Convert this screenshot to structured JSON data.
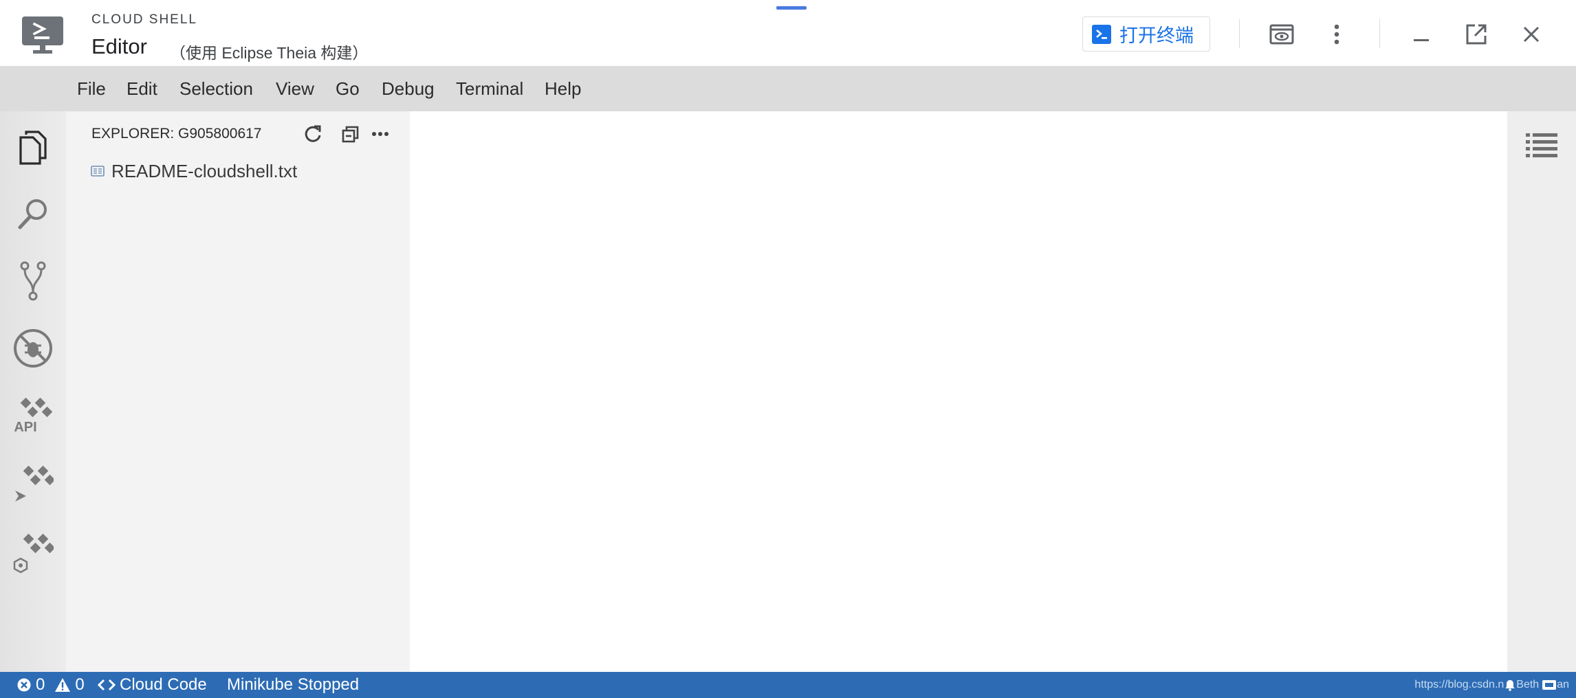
{
  "titlebar": {
    "product_name": "CLOUD SHELL",
    "editor_title": "Editor",
    "editor_subtitle": "（使用 Eclipse Theia 构建）",
    "open_terminal_label": "打开终端",
    "accent_color": "#1a73e8",
    "icons": [
      "cloud-shell-logo-icon",
      "terminal-icon",
      "web-preview-icon",
      "more-vert-icon",
      "minimize-icon",
      "open-new-window-icon",
      "close-icon"
    ]
  },
  "menu": {
    "items": [
      {
        "label": "File"
      },
      {
        "label": "Edit"
      },
      {
        "label": "Selection"
      },
      {
        "label": "View"
      },
      {
        "label": "Go"
      },
      {
        "label": "Debug"
      },
      {
        "label": "Terminal"
      },
      {
        "label": "Help"
      }
    ]
  },
  "activity_bar": {
    "items": [
      "files-icon",
      "search-icon",
      "source-control-icon",
      "debug-icon",
      "api-icon",
      "cloud-run-icon",
      "kubernetes-icon"
    ],
    "api_label": "API"
  },
  "explorer": {
    "title": "EXPLORER: G905800617",
    "files": [
      {
        "name": "README-cloudshell.txt"
      }
    ]
  },
  "statusbar": {
    "errors": "0",
    "warnings": "0",
    "cloud_code_label": "Cloud Code",
    "minikube_label": "Minikube Stopped",
    "watermark": "https://blog.csdn.n",
    "watermark_tail_1": "Beth",
    "watermark_tail_2": "an",
    "color": "#2d6cb5"
  }
}
